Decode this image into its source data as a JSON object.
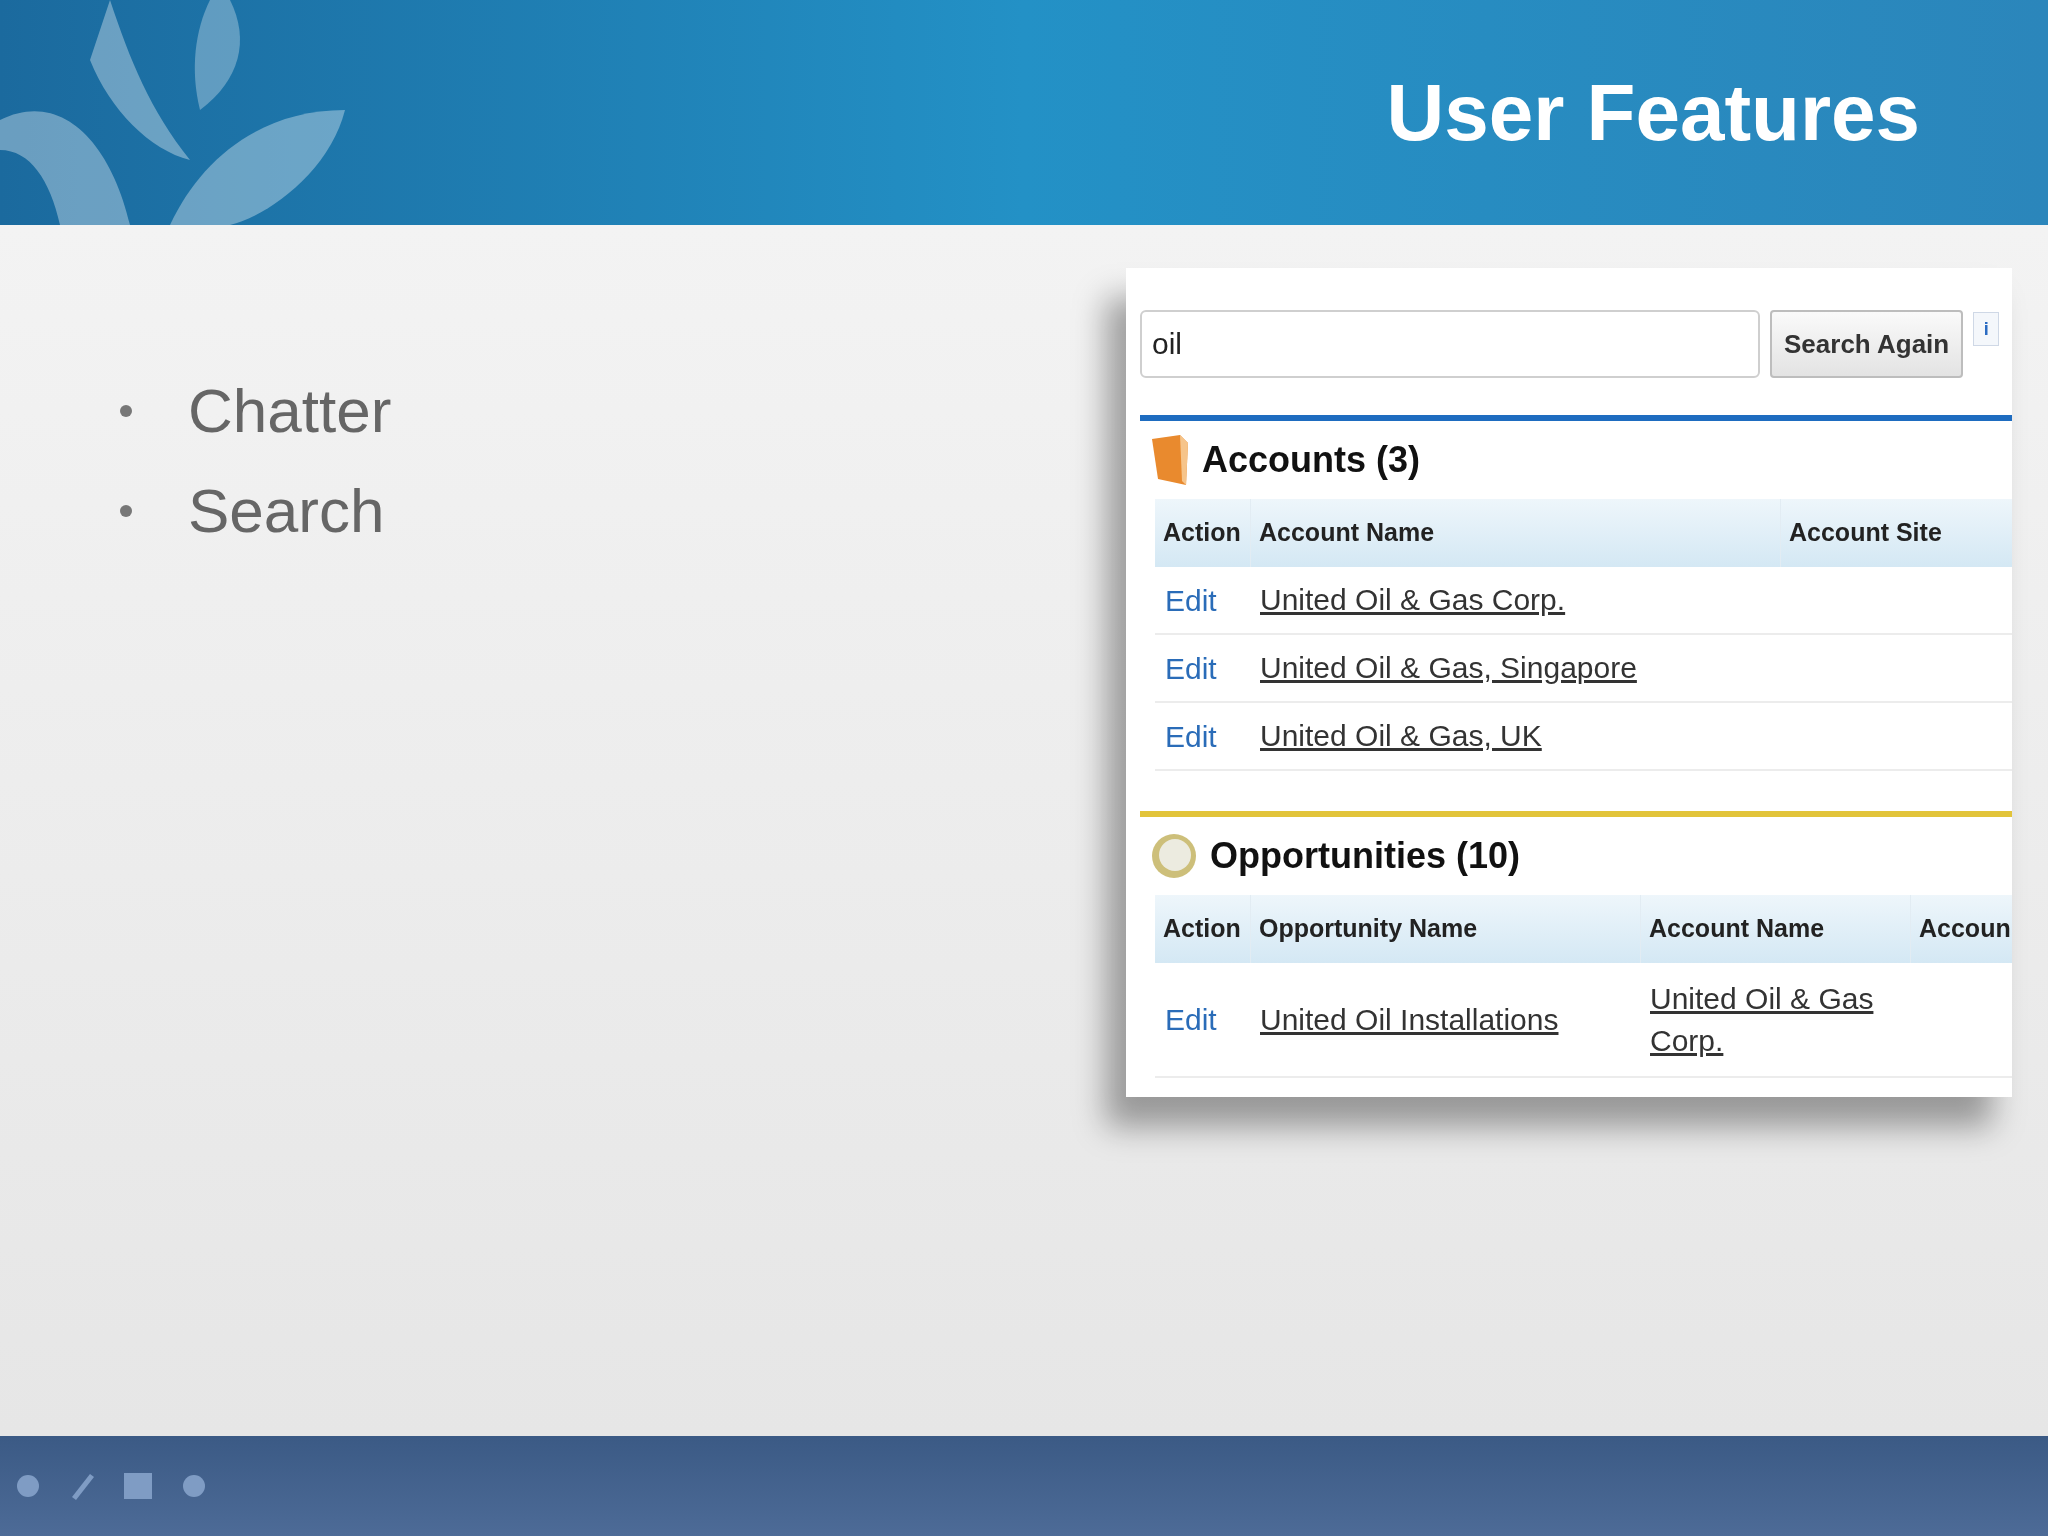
{
  "slide": {
    "title": "User Features",
    "bullets": [
      "Chatter",
      "Search"
    ]
  },
  "search_panel": {
    "search": {
      "value": "oil"
    },
    "search_button": "Search Again",
    "info_button": "i",
    "sections": [
      {
        "kind": "accounts",
        "title": "Accounts (3)",
        "color": "#1e6cc0",
        "columns": [
          "Action",
          "Account Name",
          "Account Site"
        ],
        "rows": [
          {
            "cells": [
              "Edit",
              "United Oil & Gas Corp."
            ]
          },
          {
            "cells": [
              "Edit",
              "United Oil & Gas, Singapore"
            ]
          },
          {
            "cells": [
              "Edit",
              "United Oil & Gas, UK"
            ]
          }
        ]
      },
      {
        "kind": "opportunities",
        "title": "Opportunities (10)",
        "color": "#e2c43a",
        "columns": [
          "Action",
          "Opportunity Name",
          "Account Name",
          "Accoun"
        ],
        "rows": [
          {
            "cells": [
              "Edit",
              "United Oil Installations",
              "United Oil & Gas Corp."
            ]
          }
        ]
      }
    ]
  }
}
